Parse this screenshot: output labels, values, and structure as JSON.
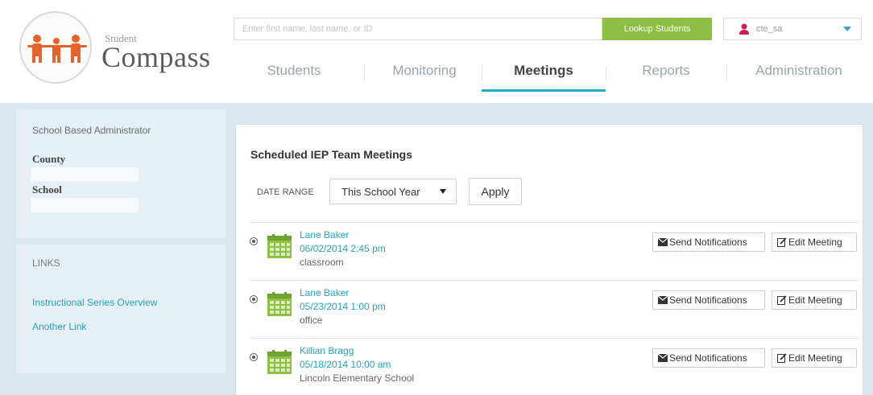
{
  "header": {
    "logo_small": "Student",
    "logo_big": "Compass",
    "search_placeholder": "Enter first name, last name, or ID",
    "lookup_label": "Lookup Students",
    "username": "cte_sa"
  },
  "nav": {
    "tabs": [
      {
        "label": "Students"
      },
      {
        "label": "Monitoring"
      },
      {
        "label": "Meetings"
      },
      {
        "label": "Reports"
      },
      {
        "label": "Administration"
      }
    ],
    "active": "Meetings"
  },
  "sidebar": {
    "role": "School Based Administrator",
    "county_label": "County",
    "school_label": "School",
    "links_title": "LINKS",
    "links": [
      {
        "label": "Instructional Series Overview"
      },
      {
        "label": "Another Link"
      }
    ]
  },
  "main": {
    "title": "Scheduled IEP Team Meetings",
    "date_range_label": "DATE RANGE",
    "date_range_value": "This School Year",
    "apply_label": "Apply",
    "notify_label": "Send Notifications",
    "edit_label": "Edit Meeting",
    "meetings": [
      {
        "name": "Lane Baker",
        "datetime": "06/02/2014 2:45 pm",
        "location": "classroom"
      },
      {
        "name": "Lane Baker",
        "datetime": "05/23/2014 1:00 pm",
        "location": "office"
      },
      {
        "name": "Killian Bragg",
        "datetime": "05/18/2014 10:00 am",
        "location": "Lincoln Elementary School"
      }
    ]
  },
  "colors": {
    "accent": "#22aac3",
    "lookup_green": "#8dbf45",
    "calendar_green": "#8dbf45",
    "body_bg": "#d8e6ee",
    "logo_orange": "#e8632a"
  }
}
